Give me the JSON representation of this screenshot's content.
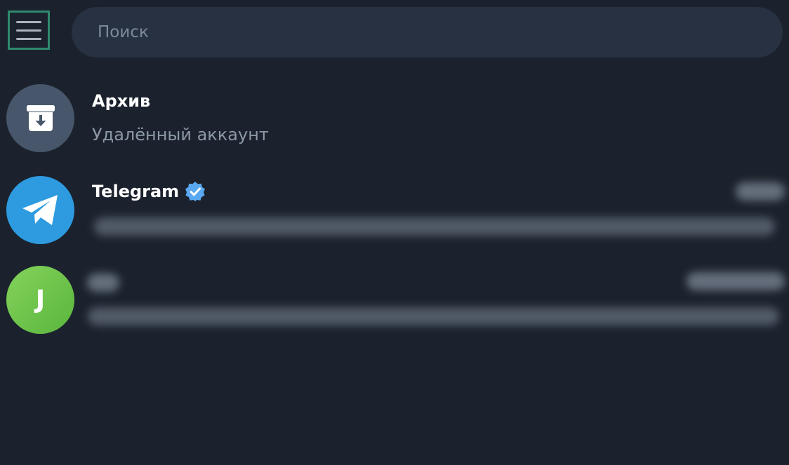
{
  "search": {
    "placeholder": "Поиск"
  },
  "chats": {
    "archive": {
      "name": "Архив",
      "preview": "Удалённый аккаунт",
      "avatar_color": "#47566a",
      "icon": "archive-box-icon"
    },
    "telegram": {
      "name": "Telegram",
      "verified_badge_color": "#5aa8f2",
      "avatar_color": "#2e9be0",
      "icon": "telegram-paper-plane-icon"
    },
    "contact_j": {
      "avatar_letter": "J",
      "avatar_color": "#6cc24a"
    }
  },
  "colors": {
    "background": "#1b222d",
    "search_background": "#273141",
    "menu_highlight": "#2f8a6e"
  }
}
